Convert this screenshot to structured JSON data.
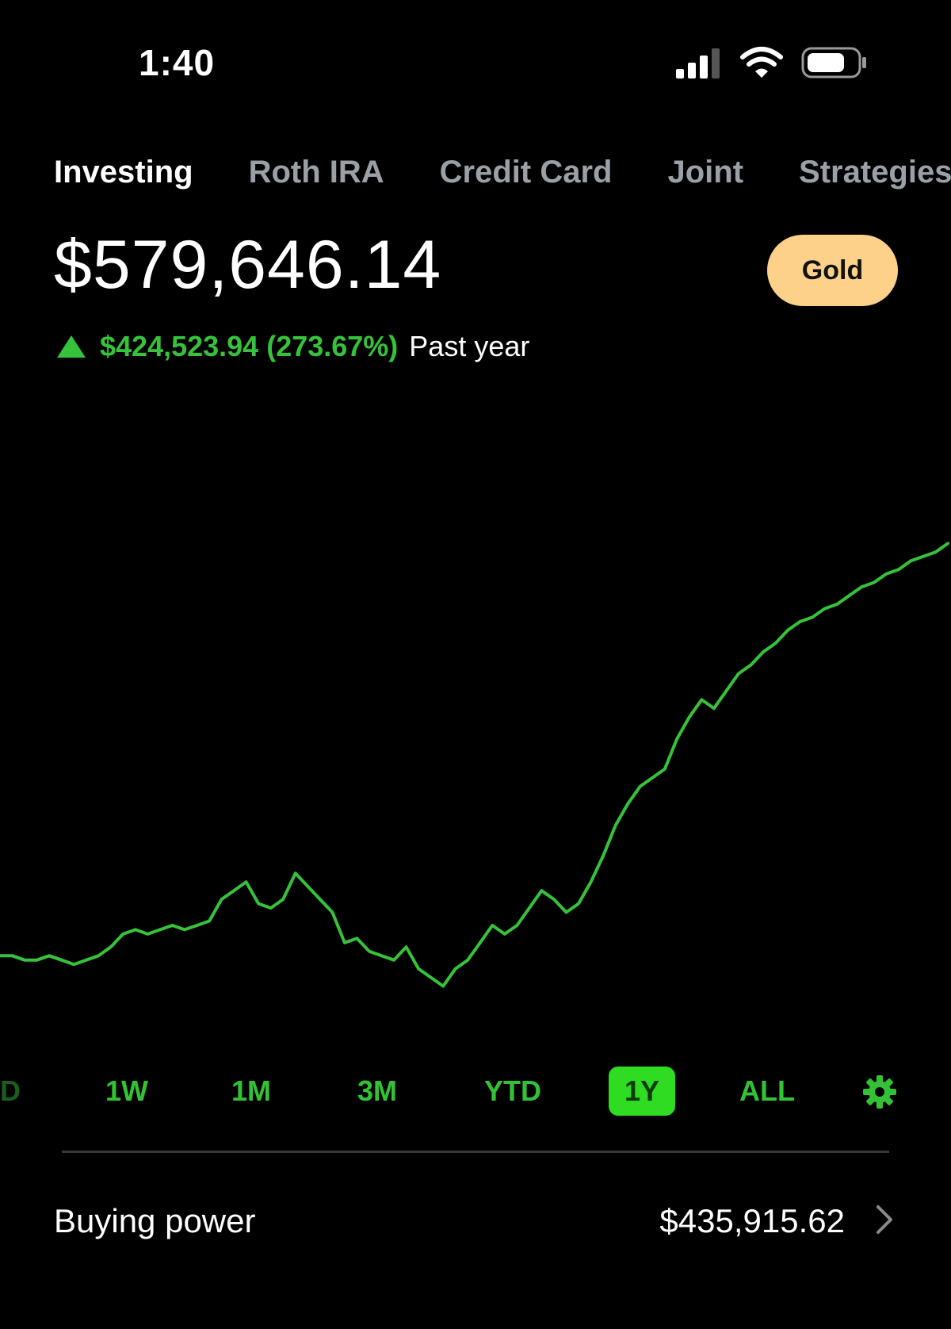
{
  "status_bar": {
    "time": "1:40",
    "icons": [
      "cellular-signal-icon",
      "wifi-icon",
      "battery-icon"
    ]
  },
  "tabs": [
    {
      "label": "Investing",
      "active": true
    },
    {
      "label": "Roth IRA",
      "active": false
    },
    {
      "label": "Credit Card",
      "active": false
    },
    {
      "label": "Joint",
      "active": false
    },
    {
      "label": "Strategies",
      "active": false
    }
  ],
  "portfolio": {
    "value": "$579,646.14",
    "badge": "Gold",
    "change": "$424,523.94 (273.67%)",
    "period": "Past year"
  },
  "colors": {
    "accent_green": "#36c23a",
    "badge_gold": "#fdd18a",
    "background": "#000000"
  },
  "chart_data": {
    "type": "line",
    "series": [
      {
        "values": [
          155,
          155,
          154,
          154,
          155,
          154,
          153,
          154,
          155,
          157,
          160,
          161,
          160,
          161,
          162,
          161,
          162,
          163,
          168,
          170,
          172,
          167,
          166,
          168,
          174,
          171,
          168,
          165,
          158,
          159,
          156,
          155,
          154,
          157,
          152,
          150,
          148,
          152,
          154,
          158,
          162,
          160,
          162,
          166,
          170,
          168,
          165,
          167,
          172,
          178,
          185,
          190,
          194,
          196,
          198,
          205,
          210,
          214,
          212,
          216,
          220,
          222,
          225,
          227,
          230,
          232,
          233,
          235,
          236,
          238,
          240,
          241,
          243,
          244,
          246,
          247,
          248,
          250
        ]
      }
    ],
    "ylim": [
      145,
      255
    ]
  },
  "ranges": {
    "partial": "D",
    "items": [
      "1W",
      "1M",
      "3M",
      "YTD",
      "1Y",
      "ALL"
    ],
    "selected": "1Y",
    "settings_icon": "gear-icon"
  },
  "buying_power": {
    "label": "Buying power",
    "value": "$435,915.62"
  }
}
